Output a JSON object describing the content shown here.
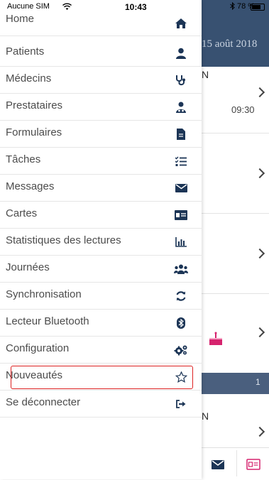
{
  "status_bar": {
    "carrier": "Aucune SIM",
    "time": "10:43",
    "battery_text": "78 %",
    "battery_level": 0.78
  },
  "background": {
    "header_date": "15 août 2018",
    "section_letter_1": "N",
    "section_letter_2": "N",
    "appointment_time": "09:30",
    "badge_count": "1"
  },
  "menu": {
    "items": [
      {
        "label": "Home",
        "icon": "home-icon"
      },
      {
        "label": "Patients",
        "icon": "user-icon"
      },
      {
        "label": "Médecins",
        "icon": "stethoscope-icon"
      },
      {
        "label": "Prestataires",
        "icon": "user-group-icon"
      },
      {
        "label": "Formulaires",
        "icon": "file-icon"
      },
      {
        "label": "Tâches",
        "icon": "tasks-icon"
      },
      {
        "label": "Messages",
        "icon": "envelope-icon"
      },
      {
        "label": "Cartes",
        "icon": "id-card-icon"
      },
      {
        "label": "Statistiques des lectures",
        "icon": "bar-chart-icon"
      },
      {
        "label": "Journées",
        "icon": "users-icon"
      },
      {
        "label": "Synchronisation",
        "icon": "sync-icon"
      },
      {
        "label": "Lecteur Bluetooth",
        "icon": "bluetooth-icon"
      },
      {
        "label": "Configuration",
        "icon": "cogs-icon"
      },
      {
        "label": "Nouveautés",
        "icon": "star-icon"
      },
      {
        "label": "Se déconnecter",
        "icon": "sign-out-icon"
      }
    ]
  },
  "colors": {
    "icon": "#1c3556",
    "header": "#385171",
    "highlight": "#dd2222"
  }
}
